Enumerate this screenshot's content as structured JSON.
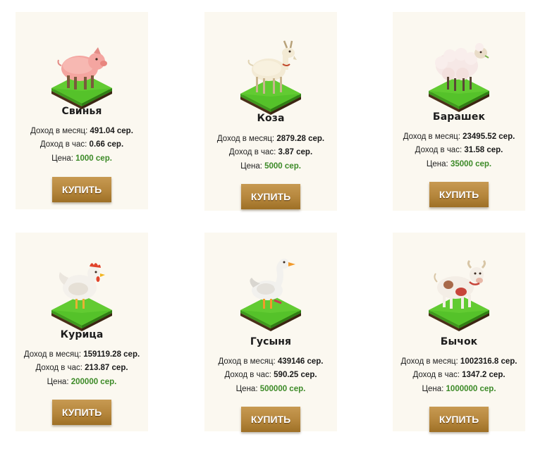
{
  "labels": {
    "income_month": "Доход в месяц:",
    "income_hour": "Доход в час:",
    "price": "Цена:"
  },
  "animals": [
    {
      "name": "Свинья",
      "month": "491.04 сер.",
      "hour": "0.66 сер.",
      "price": "1000 сер.",
      "button": "КУПИТЬ",
      "icon": "pig-icon"
    },
    {
      "name": "Коза",
      "month": "2879.28 сер.",
      "hour": "3.87 сер.",
      "price": "5000 сер.",
      "button": "КУПИТЬ",
      "icon": "goat-icon"
    },
    {
      "name": "Барашек",
      "month": "23495.52 сер.",
      "hour": "31.58 сер.",
      "price": "35000 сер.",
      "button": "КУПИТЬ",
      "icon": "sheep-icon"
    },
    {
      "name": "Курица",
      "month": "159119.28 сер.",
      "hour": "213.87 сер.",
      "price": "200000 сер.",
      "button": "КУПИТЬ",
      "icon": "chicken-icon"
    },
    {
      "name": "Гусыня",
      "month": "439146 сер.",
      "hour": "590.25 сер.",
      "price": "500000 сер.",
      "button": "КУПИТЬ",
      "icon": "goose-icon"
    },
    {
      "name": "Бычок",
      "month": "1002316.8 сер.",
      "hour": "1347.2 сер.",
      "price": "1000000 сер.",
      "button": "КУПИТЬ",
      "icon": "bull-calf-icon"
    }
  ],
  "colors": {
    "card_bg": "#fbf8f0",
    "price_green": "#3c8a27",
    "button_gold": "#b5863c",
    "grass": "#56c22b",
    "soil": "#6b4a2b"
  }
}
